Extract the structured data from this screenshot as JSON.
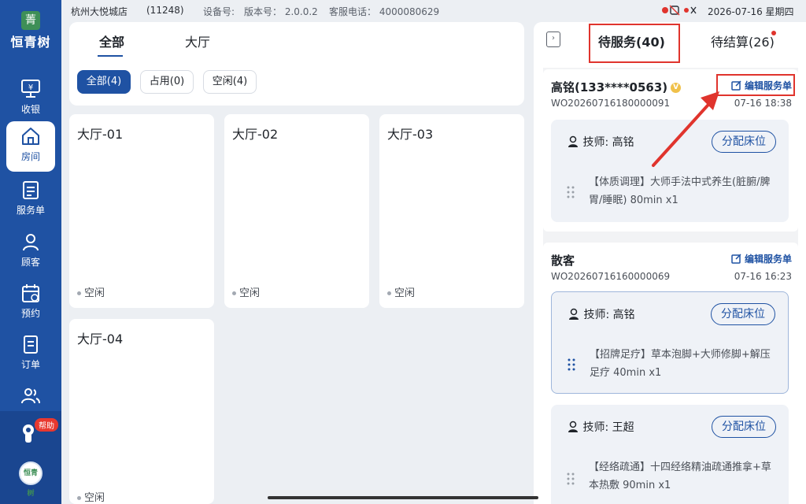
{
  "brand": {
    "mark": "菁",
    "name": "恒青树"
  },
  "nav": [
    {
      "label": "收银",
      "icon": "cashier-icon"
    },
    {
      "label": "房间",
      "icon": "home-icon"
    },
    {
      "label": "服务单",
      "icon": "service-list-icon"
    },
    {
      "label": "顾客",
      "icon": "customer-icon"
    },
    {
      "label": "预约",
      "icon": "calendar-icon"
    },
    {
      "label": "订单",
      "icon": "order-icon"
    },
    {
      "label": "",
      "icon": "staff-icon"
    }
  ],
  "help_label": "帮助",
  "avatar_text": "恒青树",
  "topbar": {
    "store": "杭州大悦城店",
    "store_id": "(11248)",
    "device": "设备号:",
    "version": "版本号：  2.0.0.2",
    "hotline": "客服电话：  4000080629",
    "datetime": "2026-07-16 星期四"
  },
  "area_tabs": [
    "全部",
    "大厅"
  ],
  "filter_chips": [
    "全部(4)",
    "占用(0)",
    "空闲(4)"
  ],
  "rooms": [
    {
      "name": "大厅-01",
      "status": "空闲"
    },
    {
      "name": "大厅-02",
      "status": "空闲"
    },
    {
      "name": "大厅-03",
      "status": "空闲"
    },
    {
      "name": "大厅-04",
      "status": "空闲"
    }
  ],
  "right": {
    "tab_pending": "待服务(40)",
    "tab_settle": "待结算(26)",
    "edit_label": "编辑服务单",
    "assign_label": "分配床位",
    "tech_prefix": "技师:",
    "orders": [
      {
        "name": "高铭(133****0563)",
        "vip": "V",
        "order_no": "WO20260716180000091",
        "time": "07-16 18:38",
        "services": [
          {
            "tech": "高铭",
            "desc": "【体质调理】大师手法中式养生(脏腑/脾胃/睡眠) 80min x1"
          }
        ]
      },
      {
        "name": "散客",
        "order_no": "WO20260716160000069",
        "time": "07-16 16:23",
        "services": [
          {
            "tech": "高铭",
            "desc": "【招牌足疗】草本泡脚+大师修脚+解压足疗 40min x1"
          },
          {
            "tech": "王超",
            "desc": "【经络疏通】十四经络精油疏通推拿+草本热敷 90min x1"
          }
        ]
      }
    ]
  },
  "colors": {
    "primary": "#1f52a3",
    "highlight": "#e0342d",
    "sidebar": "#1f52a3"
  }
}
